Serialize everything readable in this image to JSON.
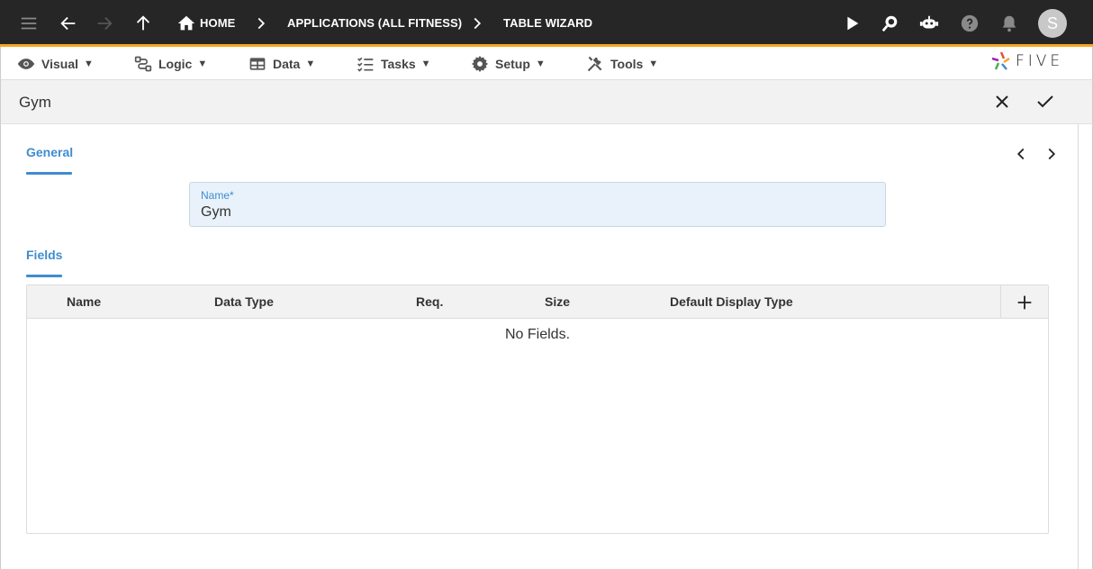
{
  "topbar": {
    "breadcrumbs": [
      {
        "label": "HOME"
      },
      {
        "label": "APPLICATIONS (ALL FITNESS)"
      },
      {
        "label": "TABLE WIZARD"
      }
    ],
    "avatar_initial": "S",
    "icons": [
      "menu-icon",
      "back-arrow-icon",
      "forward-arrow-icon",
      "up-arrow-icon",
      "home-icon",
      "play-icon",
      "search-chat-icon",
      "robot-icon",
      "help-icon",
      "bell-icon"
    ]
  },
  "menubar": {
    "items": [
      {
        "label": "Visual",
        "icon": "eye-icon"
      },
      {
        "label": "Logic",
        "icon": "logic-flow-icon"
      },
      {
        "label": "Data",
        "icon": "table-icon"
      },
      {
        "label": "Tasks",
        "icon": "checklist-icon"
      },
      {
        "label": "Setup",
        "icon": "gear-icon"
      },
      {
        "label": "Tools",
        "icon": "tools-icon"
      }
    ],
    "caret": "▼",
    "logo_text": "FIVE"
  },
  "page": {
    "title": "Gym"
  },
  "form": {
    "general_tab": "General",
    "name_label": "Name",
    "required_mark": "*",
    "name_value": "Gym",
    "fields_tab": "Fields"
  },
  "fields_table": {
    "columns": [
      "Name",
      "Data Type",
      "Req.",
      "Size",
      "Default Display Type"
    ],
    "empty_message": "No Fields."
  },
  "colors": {
    "topbar_bg": "#262626",
    "accent_orange": "#f5a623",
    "accent_blue": "#3f8cd0",
    "field_bg": "#e9f2fb"
  }
}
